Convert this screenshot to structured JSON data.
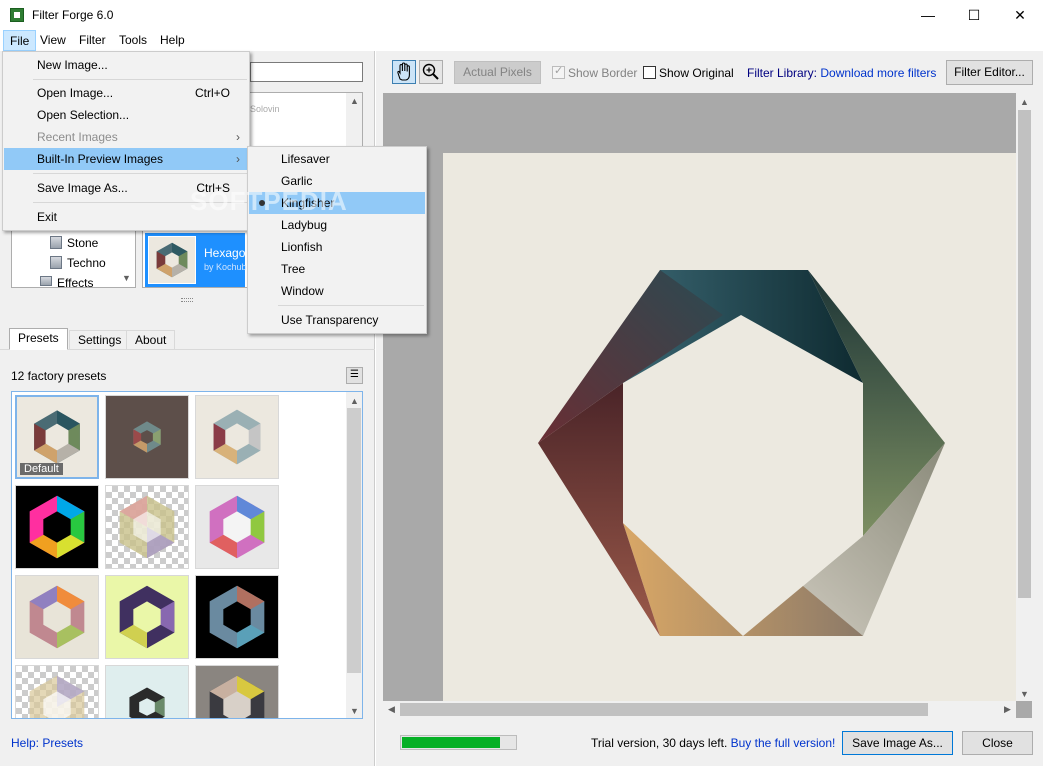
{
  "window": {
    "title": "Filter Forge 6.0",
    "controls": [
      "—",
      "☐",
      "✕"
    ]
  },
  "menubar": {
    "items": [
      "File",
      "View",
      "Filter",
      "Tools",
      "Help"
    ]
  },
  "file_menu": {
    "items": [
      {
        "label": "New Image...",
        "shortcut": ""
      },
      {
        "label": "Open Image...",
        "shortcut": "Ctrl+O"
      },
      {
        "label": "Open Selection...",
        "shortcut": ""
      },
      {
        "label": "Recent Images",
        "shortcut": ""
      },
      {
        "label": "Built-In Preview Images",
        "shortcut": ""
      },
      {
        "label": "Save Image As...",
        "shortcut": "Ctrl+S"
      },
      {
        "label": "Exit",
        "shortcut": ""
      }
    ]
  },
  "preview_menu": {
    "items": [
      "Lifesaver",
      "Garlic",
      "Kingfisher",
      "Ladybug",
      "Lionfish",
      "Tree",
      "Window",
      "Use Transparency"
    ],
    "selected": "Kingfisher"
  },
  "watermark": "SOFTPEDIA",
  "tree": {
    "items": [
      "Stone",
      "Techno",
      "Effects"
    ]
  },
  "filter_list": {
    "author_top": "Solovin",
    "selected_name": "Hexagon",
    "selected_author": "by Kochub"
  },
  "tabs": [
    "Presets",
    "Settings",
    "About"
  ],
  "presets": {
    "count_text": "12 factory presets",
    "default_label": "Default"
  },
  "help_link": "Help: Presets",
  "toolbar": {
    "actual_pixels": "Actual Pixels",
    "show_border": "Show Border",
    "show_original": "Show Original",
    "library_prefix": "Filter Library: ",
    "library_link": "Download more filters",
    "filter_editor": "Filter Editor..."
  },
  "footer": {
    "progress": 0.87,
    "trial_text": "Trial version, 30 days left. ",
    "buy_link": "Buy the full version!",
    "save_button": "Save Image As...",
    "close_button": "Close"
  },
  "colors": {
    "accent": "#0078d7",
    "selection": "#91c9f7",
    "progress": "#06b025",
    "canvas_bg": "#ece9e0"
  }
}
